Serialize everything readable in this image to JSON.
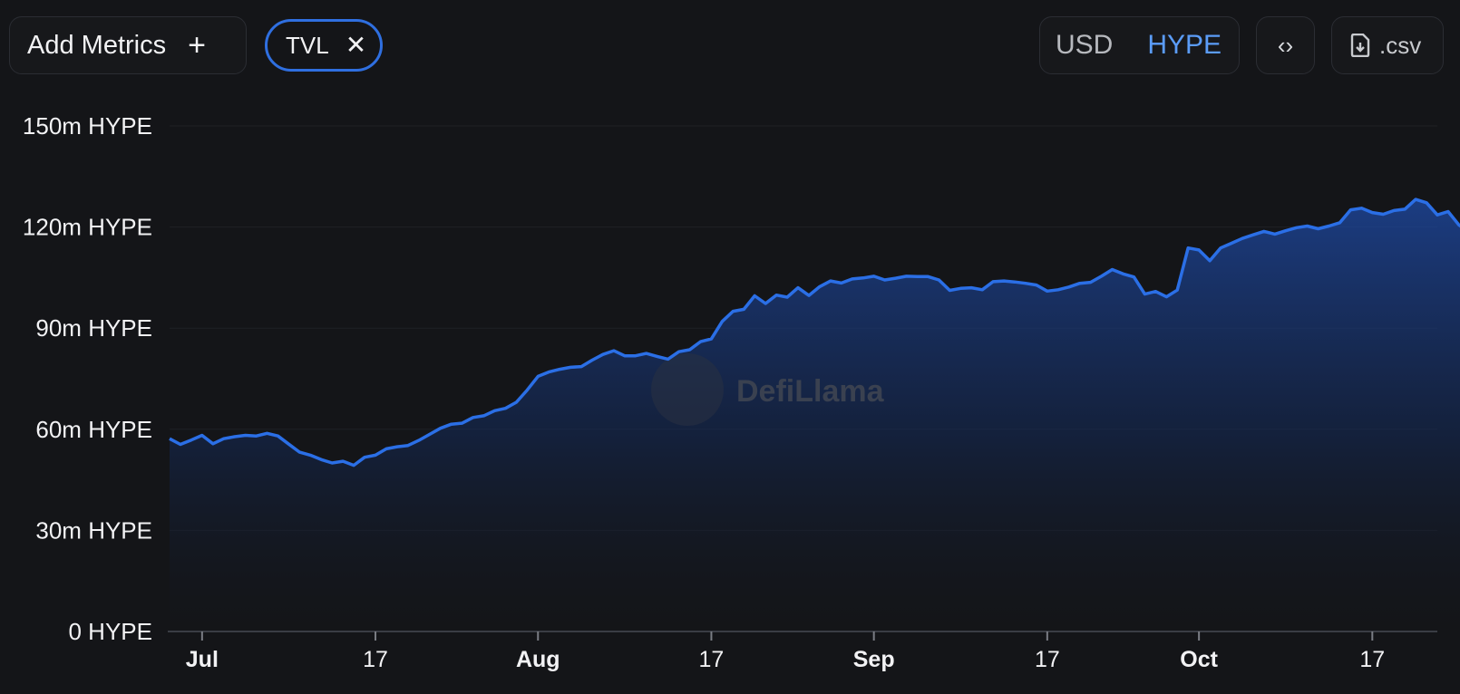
{
  "toolbar": {
    "add_metrics_label": "Add Metrics",
    "add_icon": "plus-icon",
    "active_metric": "TVL",
    "remove_icon": "close-icon",
    "denomination_options": [
      "USD",
      "HYPE"
    ],
    "denomination_selected": "HYPE",
    "embed_icon": "code-icon",
    "csv_label": ".csv",
    "csv_icon": "file-download-icon"
  },
  "watermark": "DefiLlama",
  "colors": {
    "background": "#141518",
    "line": "#2b6fe6",
    "accent": "#5b9cf7",
    "watermark": "#3a4150"
  },
  "chart_data": {
    "type": "area",
    "x_start": "2025-06-28",
    "x_end": "2025-10-23",
    "ylim": [
      0,
      150
    ],
    "y_unit": "m HYPE",
    "y_ticks": [
      "0 HYPE",
      "30m HYPE",
      "60m HYPE",
      "90m HYPE",
      "120m HYPE",
      "150m HYPE"
    ],
    "x_ticks": [
      {
        "date": "2025-07-01",
        "label": "Jul",
        "major": true
      },
      {
        "date": "2025-07-17",
        "label": "17",
        "major": false
      },
      {
        "date": "2025-08-01",
        "label": "Aug",
        "major": true
      },
      {
        "date": "2025-08-17",
        "label": "17",
        "major": false
      },
      {
        "date": "2025-09-01",
        "label": "Sep",
        "major": true
      },
      {
        "date": "2025-09-17",
        "label": "17",
        "major": false
      },
      {
        "date": "2025-10-01",
        "label": "Oct",
        "major": true
      },
      {
        "date": "2025-10-17",
        "label": "17",
        "major": false
      }
    ],
    "grid": true,
    "series": [
      {
        "name": "TVL",
        "values": [
          [
            0,
            57.2
          ],
          [
            1,
            55.5
          ],
          [
            2,
            56.8
          ],
          [
            3,
            58.2
          ],
          [
            4,
            55.7
          ],
          [
            5,
            57.2
          ],
          [
            6,
            57.8
          ],
          [
            7,
            58.2
          ],
          [
            8,
            58.0
          ],
          [
            9,
            58.8
          ],
          [
            10,
            58.0
          ],
          [
            11,
            55.6
          ],
          [
            12,
            53.2
          ],
          [
            13,
            52.3
          ],
          [
            14,
            51.0
          ],
          [
            15,
            50.0
          ],
          [
            16,
            50.5
          ],
          [
            17,
            49.3
          ],
          [
            18,
            51.7
          ],
          [
            19,
            52.3
          ],
          [
            20,
            54.2
          ],
          [
            21,
            54.8
          ],
          [
            22,
            55.2
          ],
          [
            23,
            56.7
          ],
          [
            24,
            58.5
          ],
          [
            25,
            60.3
          ],
          [
            26,
            61.5
          ],
          [
            27,
            61.8
          ],
          [
            28,
            63.5
          ],
          [
            29,
            64.0
          ],
          [
            30,
            65.5
          ],
          [
            31,
            66.2
          ],
          [
            32,
            68.0
          ],
          [
            33,
            71.6
          ],
          [
            34,
            75.7
          ],
          [
            35,
            77.0
          ],
          [
            36,
            77.8
          ],
          [
            37,
            78.4
          ],
          [
            38,
            78.6
          ],
          [
            39,
            80.5
          ],
          [
            40,
            82.2
          ],
          [
            41,
            83.3
          ],
          [
            42,
            81.8
          ],
          [
            43,
            81.8
          ],
          [
            44,
            82.5
          ],
          [
            45,
            81.6
          ],
          [
            46,
            80.8
          ],
          [
            47,
            83.0
          ],
          [
            48,
            83.6
          ],
          [
            49,
            86.0
          ],
          [
            50,
            86.8
          ],
          [
            51,
            92.0
          ],
          [
            52,
            95.0
          ],
          [
            53,
            95.6
          ],
          [
            54,
            99.6
          ],
          [
            55,
            97.3
          ],
          [
            56,
            99.8
          ],
          [
            57,
            99.2
          ],
          [
            58,
            102.0
          ],
          [
            59,
            99.7
          ],
          [
            60,
            102.3
          ],
          [
            61,
            104.0
          ],
          [
            62,
            103.4
          ],
          [
            63,
            104.6
          ],
          [
            64,
            104.9
          ],
          [
            65,
            105.4
          ],
          [
            66,
            104.3
          ],
          [
            67,
            104.8
          ],
          [
            68,
            105.4
          ],
          [
            69,
            105.3
          ],
          [
            70,
            105.3
          ],
          [
            71,
            104.3
          ],
          [
            72,
            101.2
          ],
          [
            73,
            101.8
          ],
          [
            74,
            102.0
          ],
          [
            75,
            101.4
          ],
          [
            76,
            103.8
          ],
          [
            77,
            104.0
          ],
          [
            78,
            103.7
          ],
          [
            79,
            103.3
          ],
          [
            80,
            102.8
          ],
          [
            81,
            101.0
          ],
          [
            82,
            101.4
          ],
          [
            83,
            102.2
          ],
          [
            84,
            103.3
          ],
          [
            85,
            103.6
          ],
          [
            86,
            105.4
          ],
          [
            87,
            107.4
          ],
          [
            88,
            106.1
          ],
          [
            89,
            105.2
          ],
          [
            90,
            100.1
          ],
          [
            91,
            100.9
          ],
          [
            92,
            99.3
          ],
          [
            93,
            101.3
          ],
          [
            94,
            113.8
          ],
          [
            95,
            113.2
          ],
          [
            96,
            110.0
          ],
          [
            97,
            113.8
          ],
          [
            98,
            115.2
          ],
          [
            99,
            116.6
          ],
          [
            100,
            117.7
          ],
          [
            101,
            118.7
          ],
          [
            102,
            117.9
          ],
          [
            103,
            118.9
          ],
          [
            104,
            119.8
          ],
          [
            105,
            120.3
          ],
          [
            106,
            119.5
          ],
          [
            107,
            120.3
          ],
          [
            108,
            121.3
          ],
          [
            109,
            125.1
          ],
          [
            110,
            125.6
          ],
          [
            111,
            124.3
          ],
          [
            112,
            123.8
          ],
          [
            113,
            124.9
          ],
          [
            114,
            125.3
          ],
          [
            115,
            128.2
          ],
          [
            116,
            127.2
          ],
          [
            117,
            123.6
          ],
          [
            118,
            124.6
          ],
          [
            119,
            120.6
          ],
          [
            120,
            118.5
          ],
          [
            121,
            124.9
          ]
        ]
      }
    ]
  }
}
